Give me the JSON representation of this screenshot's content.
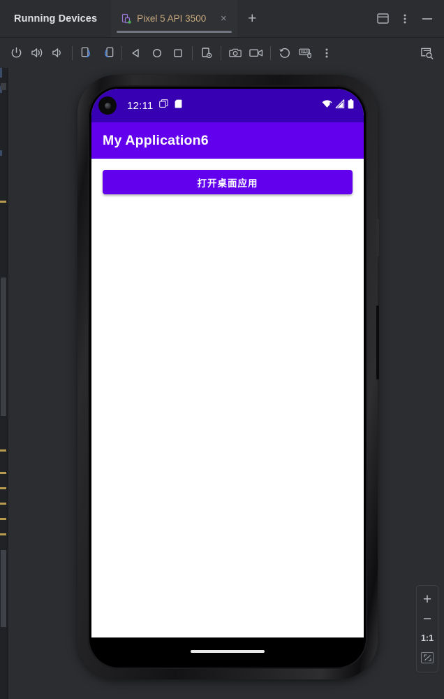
{
  "window": {
    "tool_title": "Running Devices",
    "controls": [
      {
        "name": "show-options-panel",
        "icon": "panel-icon"
      },
      {
        "name": "more-options",
        "icon": "more-vertical-icon"
      },
      {
        "name": "minimize",
        "icon": "minimize-icon"
      }
    ]
  },
  "tabs": {
    "items": [
      {
        "label": "Pixel 5 API 3500",
        "icon": "device-running-icon",
        "close": "×",
        "active": true
      }
    ],
    "add_label": "+"
  },
  "toolbar": {
    "buttons": [
      {
        "name": "power-button",
        "icon": "power-icon",
        "tooltip": "Power"
      },
      {
        "name": "volume-up-button",
        "icon": "volume-up-icon",
        "tooltip": "Volume Up"
      },
      {
        "name": "volume-down-button",
        "icon": "volume-down-icon",
        "tooltip": "Volume Down"
      },
      {
        "name": "rotate-left-button",
        "icon": "rotate-left-icon",
        "tooltip": "Rotate Left"
      },
      {
        "name": "rotate-right-button",
        "icon": "rotate-right-icon",
        "tooltip": "Rotate Right"
      },
      {
        "name": "back-button",
        "icon": "back-triangle-icon",
        "tooltip": "Back"
      },
      {
        "name": "home-button",
        "icon": "home-circle-icon",
        "tooltip": "Home"
      },
      {
        "name": "overview-button",
        "icon": "overview-square-icon",
        "tooltip": "Overview"
      },
      {
        "name": "device-settings-button",
        "icon": "device-gear-icon",
        "tooltip": "Device Settings"
      },
      {
        "name": "screenshot-button",
        "icon": "camera-icon",
        "tooltip": "Take Screenshot"
      },
      {
        "name": "record-button",
        "icon": "video-camera-icon",
        "tooltip": "Record Screen"
      },
      {
        "name": "back-navigation-button",
        "icon": "history-rotate-icon",
        "tooltip": "Back"
      },
      {
        "name": "hardware-input-button",
        "icon": "keyboard-mouse-icon",
        "tooltip": "Hardware Input"
      },
      {
        "name": "more-actions-button",
        "icon": "more-vertical-icon",
        "tooltip": "More"
      },
      {
        "name": "inspect-button",
        "icon": "layout-inspector-icon",
        "tooltip": "Layout Inspector"
      }
    ]
  },
  "device": {
    "status_bar": {
      "time": "12:11",
      "left_icons": [
        "screenshot-stack-icon",
        "sd-card-icon"
      ],
      "right_icons": [
        "wifi-warning-icon",
        "cellular-signal-icon",
        "battery-full-icon"
      ]
    },
    "app_bar": {
      "title": "My Application6"
    },
    "content": {
      "primary_button": "打开桌面应用"
    },
    "nav": {
      "type": "gesture-pill"
    }
  },
  "zoom_controls": {
    "zoom_in": "+",
    "zoom_out": "−",
    "actual_size": "1:1",
    "fit_label": "fit-to-screen"
  },
  "colors": {
    "ide_bg": "#2b2d30",
    "tab_text": "#c8a97e",
    "status_bar": "#3700B3",
    "app_bar": "#6200EE",
    "button": "#6200EE",
    "screen_bg": "#ffffff",
    "marker": "#b89b4e"
  }
}
